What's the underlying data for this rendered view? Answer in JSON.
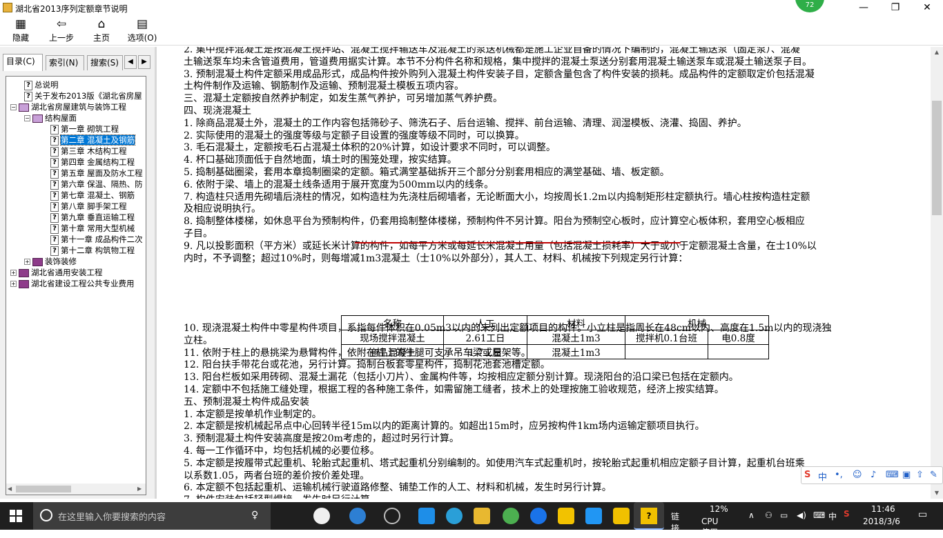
{
  "window": {
    "title": "湖北省2013序列定额章节说明",
    "badge": "72"
  },
  "toolbar": {
    "buttons": [
      {
        "label": "隐藏"
      },
      {
        "label": "上一步"
      },
      {
        "label": "主页"
      },
      {
        "label": "选项(O)"
      }
    ]
  },
  "left_tabs": [
    {
      "label": "目录(C)"
    },
    {
      "label": "索引(N)"
    },
    {
      "label": "搜索(S)"
    }
  ],
  "tree": [
    {
      "label": "总说明"
    },
    {
      "label": "关于发布2013版《湖北省房屋"
    },
    {
      "label": "湖北省房屋建筑与装饰工程"
    },
    {
      "label": "结构屋面"
    },
    {
      "label": "第一章 砌筑工程"
    },
    {
      "label": "第二章 混凝土及钢筋"
    },
    {
      "label": "第三章 木结构工程"
    },
    {
      "label": "第四章 金属结构工程"
    },
    {
      "label": "第五章 屋面及防水工程"
    },
    {
      "label": "第六章 保温、隔热、防"
    },
    {
      "label": "第七章 混凝土、钢筋"
    },
    {
      "label": "第八章 脚手架工程"
    },
    {
      "label": "第九章 垂直运输工程"
    },
    {
      "label": "第十章 常用大型机械"
    },
    {
      "label": "第十一章 成品构件二次"
    },
    {
      "label": "第十二章 构筑物工程"
    },
    {
      "label": "装饰装修"
    },
    {
      "label": "湖北省通用安装工程"
    },
    {
      "label": "湖北省建设工程公共专业费用"
    }
  ],
  "content": {
    "lines": [
      "2. 集中搅拌混凝土是按混凝土搅拌站、混凝土搅拌输送车及混凝土的泵送机械都是施工企业自备的情况下编制的，混凝土输送泵（固定泵）、混凝",
      "土输送泵车均未含管道费用，管道费用据实计算。本节不分构件名称和规格，集中搅拌的混凝土泵送分别套用混凝土输送泵车或混凝土输送泵子目。",
      "3. 预制混凝土构件定额采用成品形式，成品构件按外购列入混凝土构件安装子目，定额含量包含了构件安装的损耗。成品构件的定额取定价包括混凝",
      "土构件制作及运输、钢筋制作及运输、预制混凝土模板五项内容。",
      "三、混凝土定额按自然养护制定，如发生蒸气养护，可另增加蒸气养护费。",
      "四、现浇混凝土",
      "1. 除商品混凝土外，混凝土的工作内容包括筛砂子、筛洗石子、后台运输、搅拌、前台运输、清理、润湿模板、浇灌、捣固、养护。",
      "2. 实际使用的混凝土的强度等级与定额子目设置的强度等级不同时，可以换算。",
      "3. 毛石混凝土，定额按毛石占混凝土体积的20%计算，如设计要求不同时，可以调整。",
      "4. 杯口基础顶面低于自然地面，填土时的围笼处理，按实结算。",
      "5. 捣制基础圈梁，套用本章捣制圈梁的定额。箱式满堂基础拆开三个部分分别套用相应的满堂基础、墙、板定额。",
      "6. 依附于梁、墙上的混凝土线条适用于展开宽度为500mm以内的线条。",
      "7. 构造柱只适用先砌墙后浇柱的情况，如构造柱为先浇柱后砌墙者，无论断面大小，均按周长1.2m以内捣制矩形柱定额执行。墙心柱按构造柱定额",
      "及相应说明执行。",
      "8. 捣制整体楼梯，如休息平台为预制构件，仍套用捣制整体楼梯，预制构件不另计算。阳台为预制空心板时，应计算空心板体积，套用空心板相应",
      "子目。",
      "9. 凡以投影面积（平方米）或延长米计算的构件，如每平方米或每延长米混凝土用量（包括混凝土损耗率）大于或小于定额混凝土含量，在士10%以",
      "内时，不予调整；超过10%时，则每增减1m3混凝土（士10%以外部分），其人工、材料、机械按下列规定另行计算："
    ],
    "table": {
      "headers": [
        "名称",
        "人工",
        "材料",
        "机械"
      ],
      "rows": [
        [
          "现场搅拌混凝土",
          "2.61工日",
          "混凝土1m3",
          "搅拌机0.1台班",
          "电0.8度"
        ],
        [
          "商品混凝土",
          "1.7工日",
          "混凝土1m3",
          "",
          ""
        ]
      ]
    },
    "lines2": [
      "10. 现浇混凝土构件中零星构件项目，系指每件体积在0.05m3以内的未列出定额项目的构件。小立柱是指周长在48cm以内、高度在1.5m以内的现浇独",
      "立柱。",
      "11. 依附于柱上的悬挑梁为悬臂构件，依附在柱上的牛腿可支承吊车梁或屋架等。",
      "12. 阳台扶手带花台或花池，另行计算。捣制台板套零星构件，捣制花池套池槽定额。",
      "13. 阳台栏板如采用砖砌、混凝土漏花（包括小刀片）、金属构件等，均按相应定额分别计算。现浇阳台的沿口梁已包括在定额内。",
      "14. 定额中不包括施工缝处理，根据工程的各种施工条件，如需留施工缝者，技术上的处理按施工验收规范，经济上按实结算。",
      "五、预制混凝土构件成品安装",
      "1. 本定额是按单机作业制定的。",
      "2. 本定额是按机械起吊点中心回转半径15m以内的距离计算的。如超出15m时，应另按构件1km场内运输定额项目执行。",
      "3. 预制混凝土构件安装高度是按20m考虑的，超过时另行计算。",
      "4. 每一工作循环中，均包括机械的必要位移。",
      "5. 本定额是按履带式起重机、轮胎式起重机、塔式起重机分别编制的。如使用汽车式起重机时，按轮胎式起重机相应定额子目计算，起重机台班乘",
      "以系数1.05，两者台班的差价按价差处理。",
      "6. 本定额不包括起重机、运输机械行驶道路修整、铺垫工作的人工、材料和机械，发生时另行计算。",
      "7. 构件安装包括轻型焊接，发生时另行计算。"
    ]
  },
  "ime": {
    "label": "中"
  },
  "taskbar": {
    "search_placeholder": "在这里输入你要搜索的内容",
    "tray_link": "链接",
    "cpu_percent": "12%",
    "cpu_label": "CPU使用",
    "lang": "中",
    "time": "11:46",
    "date": "2018/3/6"
  }
}
